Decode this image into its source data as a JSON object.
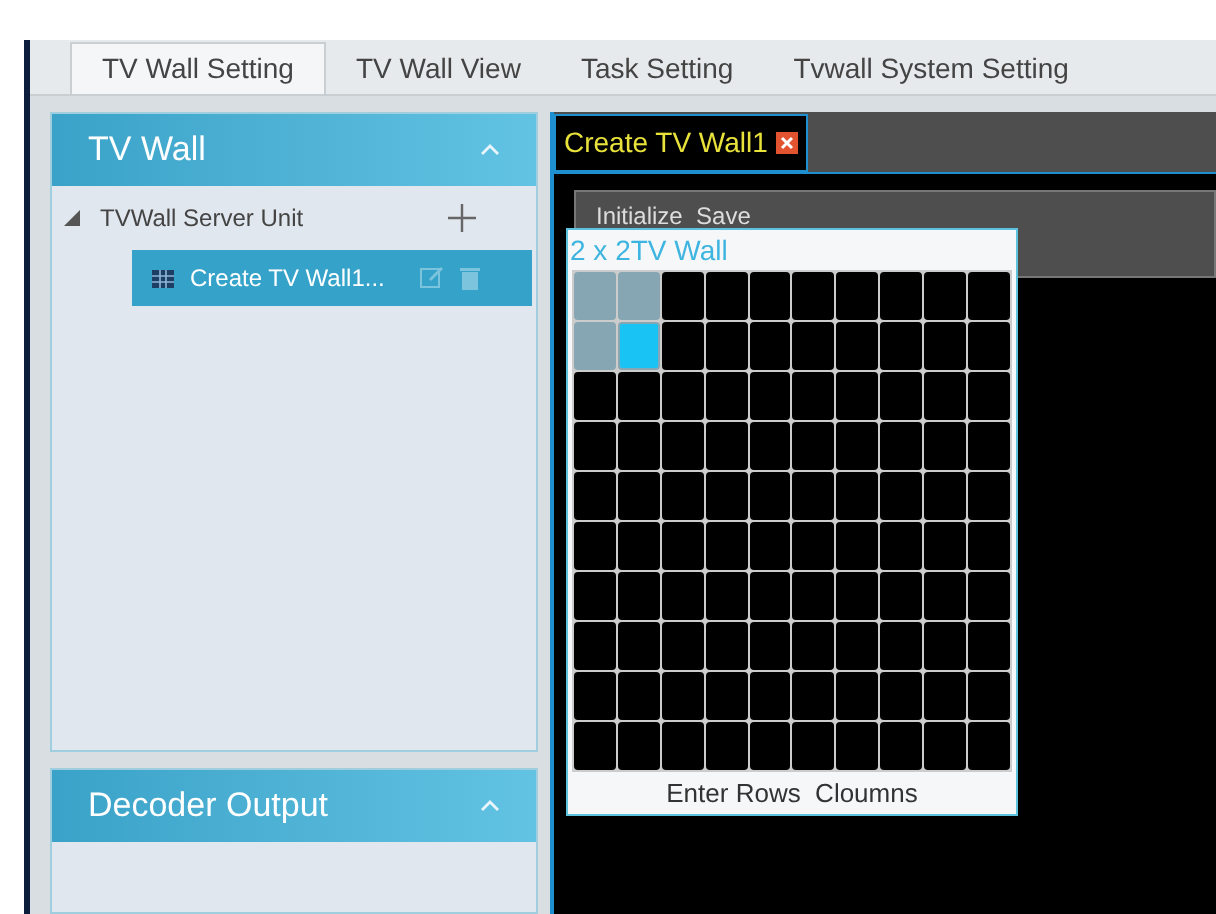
{
  "tabs": [
    {
      "label": "TV Wall Setting",
      "selected": true
    },
    {
      "label": "TV Wall View",
      "selected": false
    },
    {
      "label": "Task Setting",
      "selected": false
    },
    {
      "label": "Tvwall System Setting",
      "selected": false
    }
  ],
  "tv_wall_panel": {
    "title": "TV Wall",
    "expanded": true,
    "tree": [
      {
        "label": "TVWall Server Unit",
        "expanded": true,
        "children": [
          {
            "label": "Create TV Wall1...",
            "selected": true
          }
        ]
      }
    ]
  },
  "decoder_panel": {
    "title": "Decoder Output",
    "expanded": true
  },
  "editor_tab": {
    "label": "Create TV Wall1"
  },
  "toolbar": {
    "label": "Initialize  Save"
  },
  "layout_picker": {
    "title": "2 x 2TV Wall",
    "footer": "Enter Rows  Cloumns",
    "rows": [
      {
        "cells": [
          {
            "selected": true,
            "hovered": false
          },
          {
            "selected": true,
            "hovered": false
          },
          {
            "selected": false,
            "hovered": false
          },
          {
            "selected": false,
            "hovered": false
          },
          {
            "selected": false,
            "hovered": false
          },
          {
            "selected": false,
            "hovered": false
          },
          {
            "selected": false,
            "hovered": false
          },
          {
            "selected": false,
            "hovered": false
          },
          {
            "selected": false,
            "hovered": false
          },
          {
            "selected": false,
            "hovered": false
          }
        ]
      },
      {
        "cells": [
          {
            "selected": true,
            "hovered": false
          },
          {
            "selected": true,
            "hovered": true
          },
          {
            "selected": false,
            "hovered": false
          },
          {
            "selected": false,
            "hovered": false
          },
          {
            "selected": false,
            "hovered": false
          },
          {
            "selected": false,
            "hovered": false
          },
          {
            "selected": false,
            "hovered": false
          },
          {
            "selected": false,
            "hovered": false
          },
          {
            "selected": false,
            "hovered": false
          },
          {
            "selected": false,
            "hovered": false
          }
        ]
      },
      {
        "cells": [
          {
            "selected": false,
            "hovered": false
          },
          {
            "selected": false,
            "hovered": false
          },
          {
            "selected": false,
            "hovered": false
          },
          {
            "selected": false,
            "hovered": false
          },
          {
            "selected": false,
            "hovered": false
          },
          {
            "selected": false,
            "hovered": false
          },
          {
            "selected": false,
            "hovered": false
          },
          {
            "selected": false,
            "hovered": false
          },
          {
            "selected": false,
            "hovered": false
          },
          {
            "selected": false,
            "hovered": false
          }
        ]
      },
      {
        "cells": [
          {
            "selected": false,
            "hovered": false
          },
          {
            "selected": false,
            "hovered": false
          },
          {
            "selected": false,
            "hovered": false
          },
          {
            "selected": false,
            "hovered": false
          },
          {
            "selected": false,
            "hovered": false
          },
          {
            "selected": false,
            "hovered": false
          },
          {
            "selected": false,
            "hovered": false
          },
          {
            "selected": false,
            "hovered": false
          },
          {
            "selected": false,
            "hovered": false
          },
          {
            "selected": false,
            "hovered": false
          }
        ]
      },
      {
        "cells": [
          {
            "selected": false,
            "hovered": false
          },
          {
            "selected": false,
            "hovered": false
          },
          {
            "selected": false,
            "hovered": false
          },
          {
            "selected": false,
            "hovered": false
          },
          {
            "selected": false,
            "hovered": false
          },
          {
            "selected": false,
            "hovered": false
          },
          {
            "selected": false,
            "hovered": false
          },
          {
            "selected": false,
            "hovered": false
          },
          {
            "selected": false,
            "hovered": false
          },
          {
            "selected": false,
            "hovered": false
          }
        ]
      },
      {
        "cells": [
          {
            "selected": false,
            "hovered": false
          },
          {
            "selected": false,
            "hovered": false
          },
          {
            "selected": false,
            "hovered": false
          },
          {
            "selected": false,
            "hovered": false
          },
          {
            "selected": false,
            "hovered": false
          },
          {
            "selected": false,
            "hovered": false
          },
          {
            "selected": false,
            "hovered": false
          },
          {
            "selected": false,
            "hovered": false
          },
          {
            "selected": false,
            "hovered": false
          },
          {
            "selected": false,
            "hovered": false
          }
        ]
      },
      {
        "cells": [
          {
            "selected": false,
            "hovered": false
          },
          {
            "selected": false,
            "hovered": false
          },
          {
            "selected": false,
            "hovered": false
          },
          {
            "selected": false,
            "hovered": false
          },
          {
            "selected": false,
            "hovered": false
          },
          {
            "selected": false,
            "hovered": false
          },
          {
            "selected": false,
            "hovered": false
          },
          {
            "selected": false,
            "hovered": false
          },
          {
            "selected": false,
            "hovered": false
          },
          {
            "selected": false,
            "hovered": false
          }
        ]
      },
      {
        "cells": [
          {
            "selected": false,
            "hovered": false
          },
          {
            "selected": false,
            "hovered": false
          },
          {
            "selected": false,
            "hovered": false
          },
          {
            "selected": false,
            "hovered": false
          },
          {
            "selected": false,
            "hovered": false
          },
          {
            "selected": false,
            "hovered": false
          },
          {
            "selected": false,
            "hovered": false
          },
          {
            "selected": false,
            "hovered": false
          },
          {
            "selected": false,
            "hovered": false
          },
          {
            "selected": false,
            "hovered": false
          }
        ]
      },
      {
        "cells": [
          {
            "selected": false,
            "hovered": false
          },
          {
            "selected": false,
            "hovered": false
          },
          {
            "selected": false,
            "hovered": false
          },
          {
            "selected": false,
            "hovered": false
          },
          {
            "selected": false,
            "hovered": false
          },
          {
            "selected": false,
            "hovered": false
          },
          {
            "selected": false,
            "hovered": false
          },
          {
            "selected": false,
            "hovered": false
          },
          {
            "selected": false,
            "hovered": false
          },
          {
            "selected": false,
            "hovered": false
          }
        ]
      },
      {
        "cells": [
          {
            "selected": false,
            "hovered": false
          },
          {
            "selected": false,
            "hovered": false
          },
          {
            "selected": false,
            "hovered": false
          },
          {
            "selected": false,
            "hovered": false
          },
          {
            "selected": false,
            "hovered": false
          },
          {
            "selected": false,
            "hovered": false
          },
          {
            "selected": false,
            "hovered": false
          },
          {
            "selected": false,
            "hovered": false
          },
          {
            "selected": false,
            "hovered": false
          },
          {
            "selected": false,
            "hovered": false
          }
        ]
      }
    ]
  }
}
